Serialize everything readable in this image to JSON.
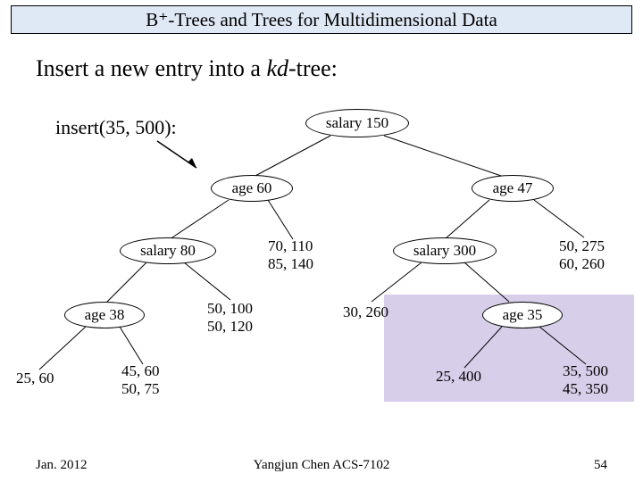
{
  "title": "B⁺-Trees and Trees for Multidimensional Data",
  "heading_prefix": "Insert a new entry into a ",
  "heading_kd": "kd",
  "heading_suffix": "-tree:",
  "insert_call": "insert(35, 500):",
  "nodes": {
    "root": "salary 150",
    "l1_left": "age 60",
    "l1_right": "age 47",
    "l2_s80": "salary 80",
    "l2_s300": "salary 300",
    "l3_age38": "age 38",
    "l3_age35": "age 35"
  },
  "leaves": {
    "n70": "70, 110\n85, 140",
    "n50a": "50, 275\n60, 260",
    "n50b": "50, 100\n50, 120",
    "n30": "30, 260",
    "n25": "25, 60",
    "n45": "45, 60\n50, 75",
    "n25b": "25, 400",
    "n35": "35, 500\n45, 350"
  },
  "footer": {
    "left": "Jan. 2012",
    "mid": "Yangjun Chen     ACS-7102",
    "right": "54"
  },
  "chart_data": {
    "type": "tree",
    "description": "kd-tree split alternately on salary then age",
    "root": {
      "split": "salary",
      "value": 150,
      "left": {
        "split": "age",
        "value": 60,
        "left": {
          "split": "salary",
          "value": 80,
          "left": {
            "split": "age",
            "value": 38,
            "left": {
              "leaf": [
                [
                  25,
                  60
                ]
              ]
            },
            "right": {
              "leaf": [
                [
                  45,
                  60
                ],
                [
                  50,
                  75
                ]
              ]
            }
          },
          "right": {
            "leaf": [
              [
                50,
                100
              ],
              [
                50,
                120
              ]
            ]
          }
        },
        "right": {
          "leaf": [
            [
              70,
              110
            ],
            [
              85,
              140
            ]
          ]
        }
      },
      "right": {
        "split": "age",
        "value": 47,
        "left": {
          "split": "salary",
          "value": 300,
          "left": {
            "leaf": [
              [
                30,
                260
              ]
            ]
          },
          "right": {
            "split": "age",
            "value": 35,
            "left": {
              "leaf": [
                [
                  25,
                  400
                ]
              ]
            },
            "right": {
              "leaf": [
                [
                  35,
                  500
                ],
                [
                  45,
                  350
                ]
              ]
            }
          }
        },
        "right": {
          "leaf": [
            [
              50,
              275
            ],
            [
              60,
              260
            ]
          ]
        }
      }
    },
    "insert_point": [
      35,
      500
    ],
    "highlighted_region": "right subtree under salary 300 (age 35 split and its children)"
  }
}
